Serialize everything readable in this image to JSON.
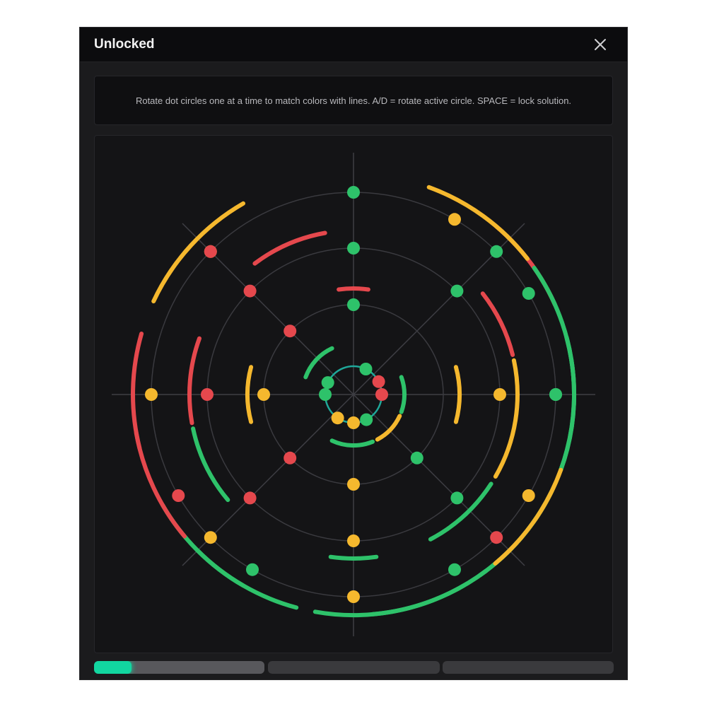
{
  "window": {
    "title": "Unlocked",
    "close_icon": "close-icon"
  },
  "instructions": {
    "text": "Rotate dot circles one at a time to match colors with lines. A/D = rotate active circle. SPACE = lock solution."
  },
  "colors": {
    "red": "#e5484d",
    "yellow": "#f5b82e",
    "green": "#2ec26a",
    "teal": "#1fa89a",
    "ring": "#3a3a3f",
    "spoke": "#3e3e44",
    "accent": "#12d6a0"
  },
  "puzzle": {
    "active_ring": 0,
    "rings": [
      {
        "dots": [
          {
            "angle": 296,
            "color": "green"
          },
          {
            "angle": 333,
            "color": "red"
          },
          {
            "angle": 0,
            "color": "red"
          },
          {
            "angle": 63,
            "color": "green"
          },
          {
            "angle": 90,
            "color": "yellow"
          },
          {
            "angle": 124,
            "color": "yellow"
          },
          {
            "angle": 180,
            "color": "green"
          },
          {
            "angle": 205,
            "color": "green"
          }
        ],
        "arcs": [
          {
            "start": 25,
            "end": 62,
            "color": "yellow"
          },
          {
            "start": 68,
            "end": 115,
            "color": "green"
          },
          {
            "start": 340,
            "end": 20,
            "color": "green"
          },
          {
            "start": 200,
            "end": 245,
            "color": "green"
          }
        ]
      },
      {
        "dots": [
          {
            "angle": 270,
            "color": "green"
          },
          {
            "angle": 45,
            "color": "green"
          },
          {
            "angle": 90,
            "color": "yellow"
          },
          {
            "angle": 135,
            "color": "red"
          },
          {
            "angle": 180,
            "color": "yellow"
          },
          {
            "angle": 225,
            "color": "red"
          }
        ],
        "arcs": [
          {
            "start": 262,
            "end": 278,
            "color": "red"
          },
          {
            "start": 345,
            "end": 15,
            "color": "yellow"
          },
          {
            "start": 165,
            "end": 195,
            "color": "yellow"
          }
        ]
      },
      {
        "dots": [
          {
            "angle": 270,
            "color": "green"
          },
          {
            "angle": 315,
            "color": "green"
          },
          {
            "angle": 0,
            "color": "yellow"
          },
          {
            "angle": 45,
            "color": "green"
          },
          {
            "angle": 90,
            "color": "yellow"
          },
          {
            "angle": 135,
            "color": "red"
          },
          {
            "angle": 180,
            "color": "red"
          },
          {
            "angle": 225,
            "color": "red"
          }
        ],
        "arcs": [
          {
            "start": 233,
            "end": 260,
            "color": "red"
          },
          {
            "start": 322,
            "end": 346,
            "color": "red"
          },
          {
            "start": 348,
            "end": 30,
            "color": "yellow"
          },
          {
            "start": 33,
            "end": 62,
            "color": "green"
          },
          {
            "start": 82,
            "end": 98,
            "color": "green"
          },
          {
            "start": 140,
            "end": 168,
            "color": "green"
          },
          {
            "start": 170,
            "end": 200,
            "color": "red"
          }
        ]
      },
      {
        "dots": [
          {
            "angle": 270,
            "color": "green"
          },
          {
            "angle": 315,
            "color": "green"
          },
          {
            "angle": 0,
            "color": "green"
          },
          {
            "angle": 45,
            "color": "red"
          },
          {
            "angle": 90,
            "color": "yellow"
          },
          {
            "angle": 135,
            "color": "yellow"
          },
          {
            "angle": 180,
            "color": "yellow"
          },
          {
            "angle": 225,
            "color": "yellow"
          }
        ],
        "arcs": [
          {
            "start": 310,
            "end": 336,
            "color": "red"
          },
          {
            "start": 345,
            "end": 20,
            "color": "green"
          },
          {
            "start": 26,
            "end": 55,
            "color": "green"
          },
          {
            "start": 60,
            "end": 80,
            "color": "green"
          },
          {
            "start": 80,
            "end": 100,
            "color": "green"
          },
          {
            "start": 120,
            "end": 150,
            "color": "green"
          },
          {
            "start": 166,
            "end": 196,
            "color": "red"
          },
          {
            "start": 205,
            "end": 240,
            "color": "yellow"
          }
        ]
      },
      {
        "dots": [
          {
            "angle": 300,
            "color": "yellow"
          },
          {
            "angle": 225,
            "color": "red"
          },
          {
            "angle": 330,
            "color": "green"
          },
          {
            "angle": 0,
            "color": "green"
          },
          {
            "angle": 30,
            "color": "yellow"
          },
          {
            "angle": 60,
            "color": "green"
          },
          {
            "angle": 150,
            "color": "red"
          },
          {
            "angle": 120,
            "color": "green"
          }
        ],
        "arcs": [
          {
            "start": 290,
            "end": 322,
            "color": "yellow"
          },
          {
            "start": 325,
            "end": 357,
            "color": "green"
          },
          {
            "start": 345,
            "end": 20,
            "color": "green"
          },
          {
            "start": 20,
            "end": 50,
            "color": "yellow"
          },
          {
            "start": 53,
            "end": 85,
            "color": "green"
          },
          {
            "start": 105,
            "end": 135,
            "color": "green"
          },
          {
            "start": 140,
            "end": 170,
            "color": "red"
          }
        ]
      }
    ]
  },
  "progress": {
    "segments": [
      {
        "value": 0.22,
        "state": "active"
      },
      {
        "value": 0,
        "state": "pending"
      },
      {
        "value": 0,
        "state": "pending"
      }
    ]
  }
}
